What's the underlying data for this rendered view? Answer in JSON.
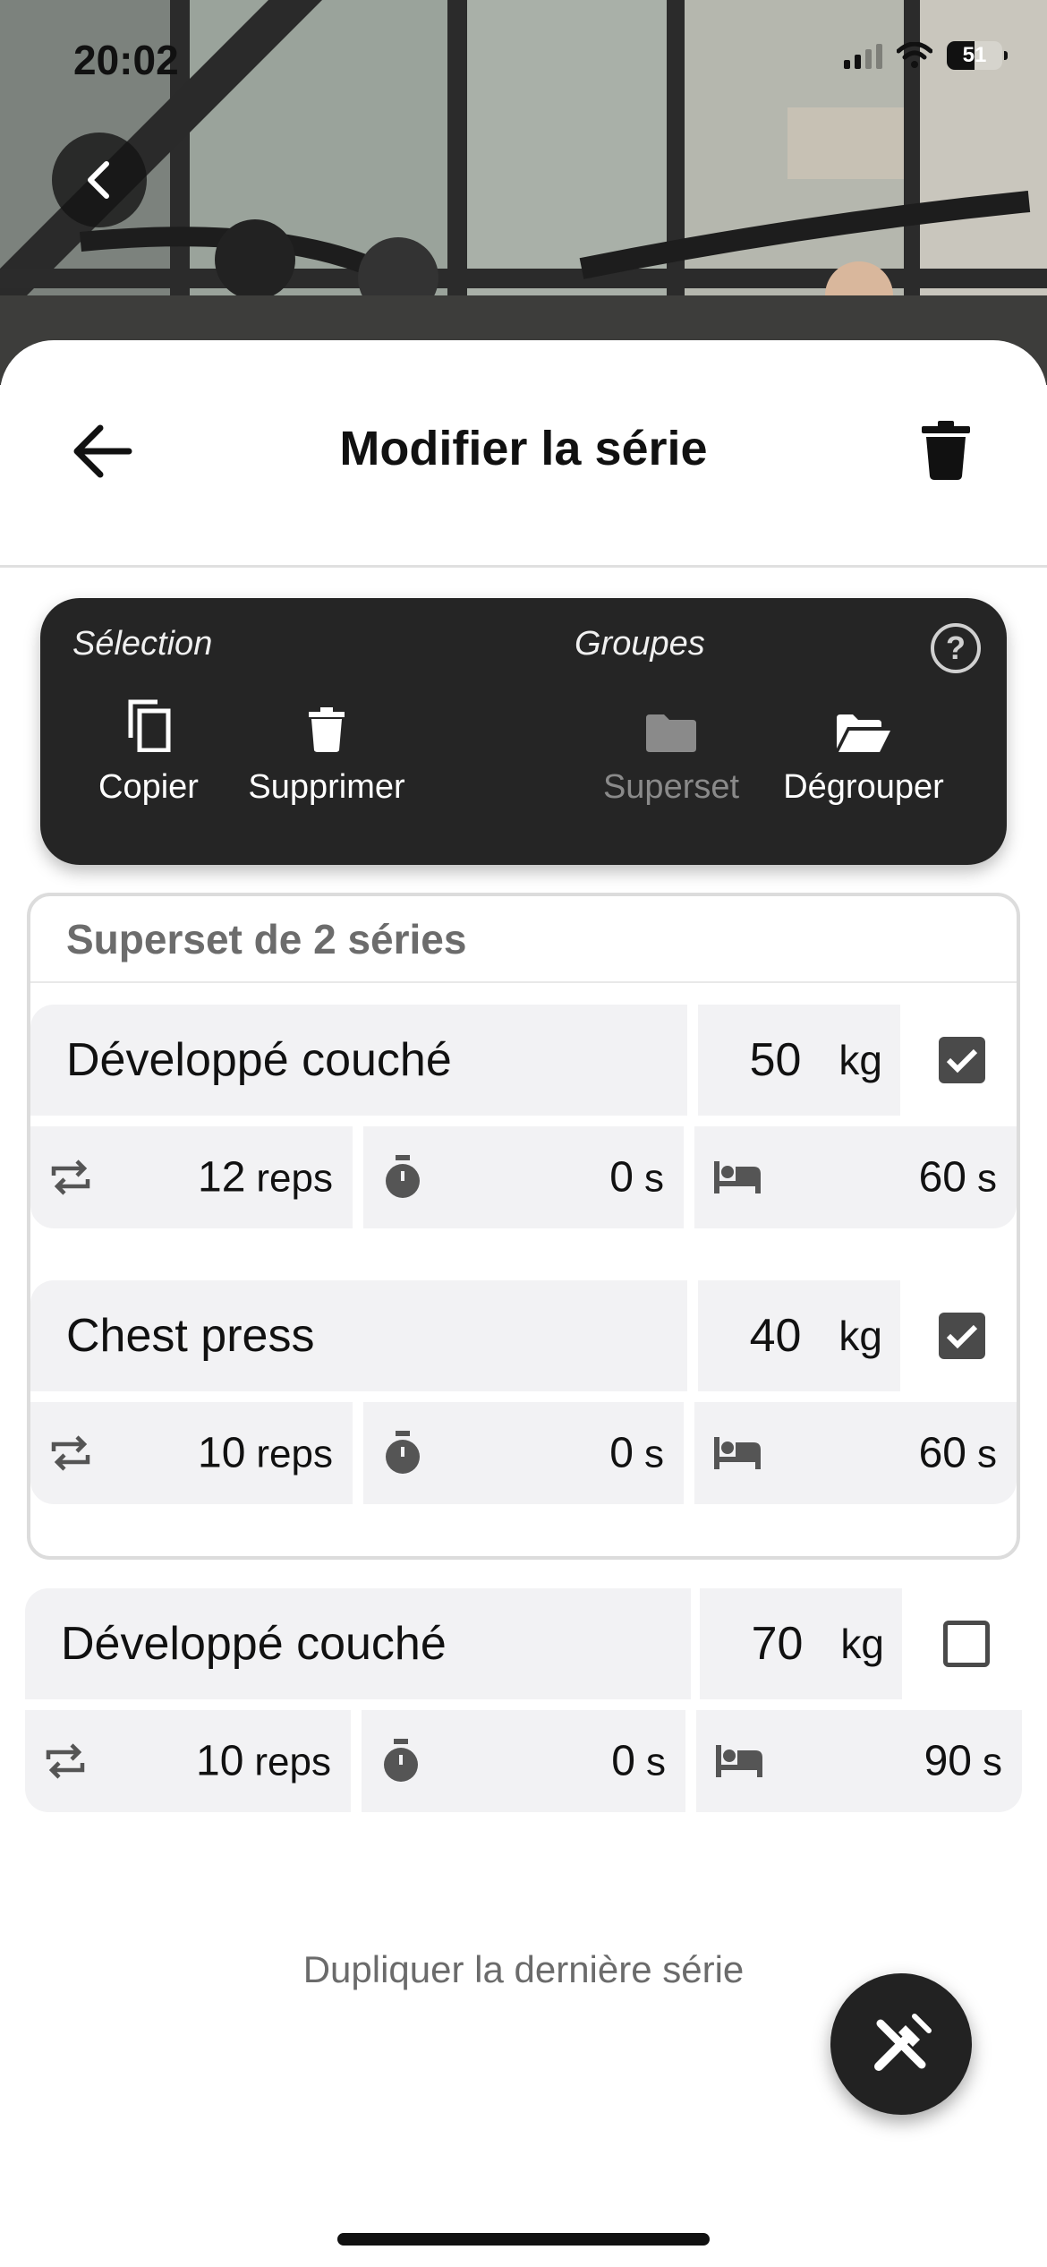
{
  "status_bar": {
    "time": "20:02",
    "battery": "51"
  },
  "header": {
    "title": "Modifier la série"
  },
  "toolbar": {
    "selection_label": "Sélection",
    "groups_label": "Groupes",
    "help_glyph": "?",
    "buttons": [
      {
        "label": "Copier",
        "icon": "copy-icon",
        "enabled": true
      },
      {
        "label": "Supprimer",
        "icon": "trash-icon",
        "enabled": true
      },
      {
        "label": "Superset",
        "icon": "folder-icon",
        "enabled": false
      },
      {
        "label": "Dégrouper",
        "icon": "folder-open-icon",
        "enabled": true
      }
    ]
  },
  "superset": {
    "title": "Superset de 2 séries",
    "sets": [
      {
        "exercise": "Développé couché",
        "weight": "50",
        "weight_unit": "kg",
        "checked": true,
        "reps": "12",
        "reps_unit": "reps",
        "duration": "0",
        "duration_unit": "s",
        "rest": "60",
        "rest_unit": "s"
      },
      {
        "exercise": "Chest press",
        "weight": "40",
        "weight_unit": "kg",
        "checked": true,
        "reps": "10",
        "reps_unit": "reps",
        "duration": "0",
        "duration_unit": "s",
        "rest": "60",
        "rest_unit": "s"
      }
    ]
  },
  "standalone_set": {
    "exercise": "Développé couché",
    "weight": "70",
    "weight_unit": "kg",
    "checked": false,
    "reps": "10",
    "reps_unit": "reps",
    "duration": "0",
    "duration_unit": "s",
    "rest": "90",
    "rest_unit": "s"
  },
  "footer": {
    "duplicate_label": "Dupliquer la dernière série"
  },
  "colors": {
    "toolbar_bg": "#252525",
    "cell_bg": "#f2f2f4",
    "fab_bg": "#222222"
  }
}
